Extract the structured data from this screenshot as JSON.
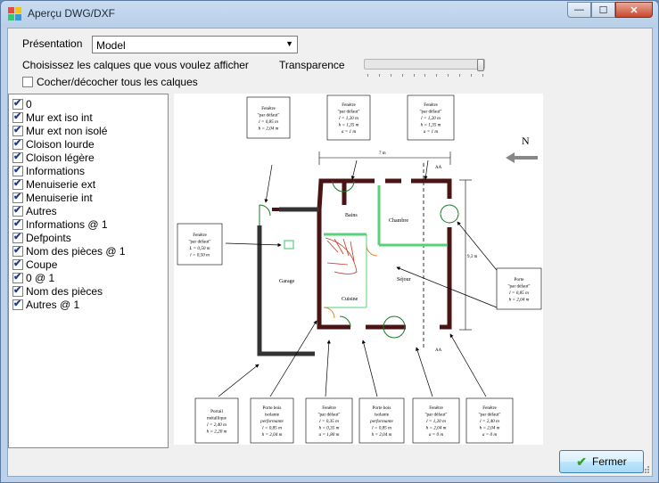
{
  "window": {
    "title": "Aperçu DWG/DXF",
    "controls": {
      "minimize": "—",
      "maximize": "☐",
      "close": "✕"
    }
  },
  "form": {
    "presentation_label": "Présentation",
    "presentation_value": "Model",
    "layers_prompt": "Choisissez les calques que vous voulez afficher",
    "transparency_label": "Transparence",
    "transparency_level": 1.0,
    "toggle_all_label": "Cocher/décocher tous les calques",
    "toggle_all_checked": false
  },
  "layers": [
    {
      "label": "0",
      "checked": true
    },
    {
      "label": "Mur ext iso int",
      "checked": true
    },
    {
      "label": "Mur ext non isolé",
      "checked": true
    },
    {
      "label": "Cloison lourde",
      "checked": true
    },
    {
      "label": "Cloison légère",
      "checked": true
    },
    {
      "label": "Informations",
      "checked": true
    },
    {
      "label": "Menuiserie ext",
      "checked": true
    },
    {
      "label": "Menuiserie int",
      "checked": true
    },
    {
      "label": "Autres",
      "checked": true
    },
    {
      "label": "Informations @ 1",
      "checked": true
    },
    {
      "label": "Defpoints",
      "checked": true
    },
    {
      "label": "Nom des pièces @ 1",
      "checked": true
    },
    {
      "label": "Coupe",
      "checked": true
    },
    {
      "label": "0 @ 1",
      "checked": true
    },
    {
      "label": "Nom des pièces",
      "checked": true
    },
    {
      "label": "Autres @ 1",
      "checked": true
    }
  ],
  "drawing": {
    "north": "N",
    "rooms": {
      "bains": "Bains",
      "chambre": "Chambre",
      "garage": "Garage",
      "sejour": "Séjour",
      "cuisine": "Cuisine"
    },
    "dims": {
      "width": "7 m",
      "height": "9,3 m",
      "section_top": "AA",
      "section_bottom": "AA"
    },
    "callouts": {
      "top1": [
        "Fenêtre",
        "\"par défaut\"",
        "l = 0,85 m",
        "h = 2,04 m"
      ],
      "top2": [
        "Fenêtre",
        "\"par défaut\"",
        "l = 1,20 m",
        "h = 1,35 m",
        "a = 1 m"
      ],
      "top3": [
        "Fenêtre",
        "\"par défaut\"",
        "l = 1,20 m",
        "h = 1,35 m",
        "a = 1 m"
      ],
      "left": [
        "Fenêtre",
        "\"par défaut\"",
        "L = 0,50 m",
        "l = 0,50 m"
      ],
      "right": [
        "Porte",
        "\"par défaut\"",
        "l = 0,85 m",
        "h = 2,04 m"
      ],
      "b1": [
        "Portail",
        "métallique",
        "l = 2,40 m",
        "h = 2,20 m"
      ],
      "b2": [
        "Porte bois",
        "isolante",
        "performante",
        "l = 0,85 m",
        "h = 2,04 m"
      ],
      "b3": [
        "Fenêtre",
        "\"par défaut\"",
        "l = 0,35 m",
        "h = 0,35 m",
        "a = 1,80 m"
      ],
      "b4": [
        "Porte bois",
        "isolante",
        "performante",
        "l = 0,85 m",
        "h = 2,04 m"
      ],
      "b5": [
        "Fenêtre",
        "\"par défaut\"",
        "l = 1,20 m",
        "h = 2,04 m",
        "a = 0 m"
      ],
      "b6": [
        "Fenêtre",
        "\"par défaut\"",
        "l = 2,40 m",
        "h = 2,04 m",
        "a = 0 m"
      ]
    }
  },
  "footer": {
    "close_label": "Fermer",
    "close_icon": "checkmark-icon"
  },
  "colors": {
    "wall": "#4a1414",
    "partition": "#5ad07a",
    "stair": "#c0392b",
    "door": "#1a7a2a"
  }
}
